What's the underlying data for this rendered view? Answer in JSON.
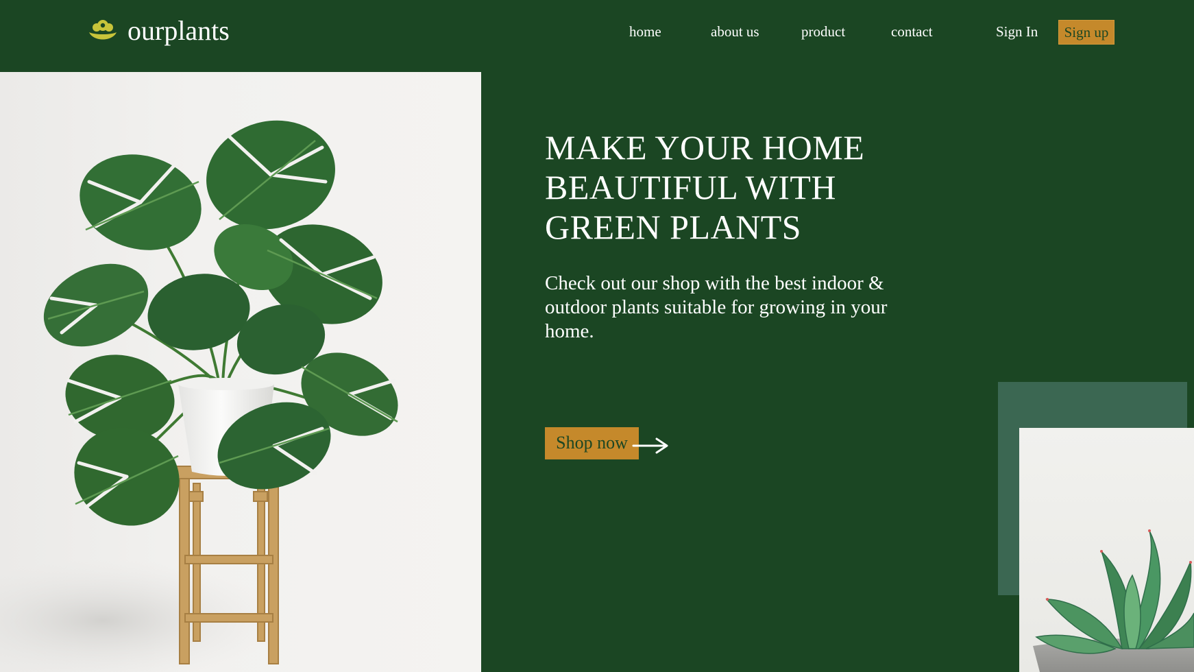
{
  "brand": {
    "name": "ourplants",
    "logo_icon": "flower-icon",
    "logo_color": "#c8c43a"
  },
  "nav": {
    "links": [
      {
        "label": "home"
      },
      {
        "label": "about us"
      },
      {
        "label": "product"
      },
      {
        "label": "contact"
      }
    ],
    "signin_label": "Sign In",
    "signup_label": "Sign up"
  },
  "hero": {
    "title_lines": [
      "MAKE YOUR HOME",
      "BEAUTIFUL WITH",
      "GREEN PLANTS"
    ],
    "subtitle": "Check out our shop with the best indoor & outdoor plants suitable for growing in your home.",
    "cta_label": "Shop now",
    "cta_icon": "arrow-right-icon"
  },
  "images": {
    "hero_image": "monstera-plant-on-wooden-stool",
    "secondary_image": "succulent-in-concrete-pot"
  },
  "colors": {
    "background": "#1b4623",
    "accent": "#c5892b",
    "accent_text": "#1b4623",
    "decor_square": "#3b6752",
    "text": "#ffffff"
  }
}
